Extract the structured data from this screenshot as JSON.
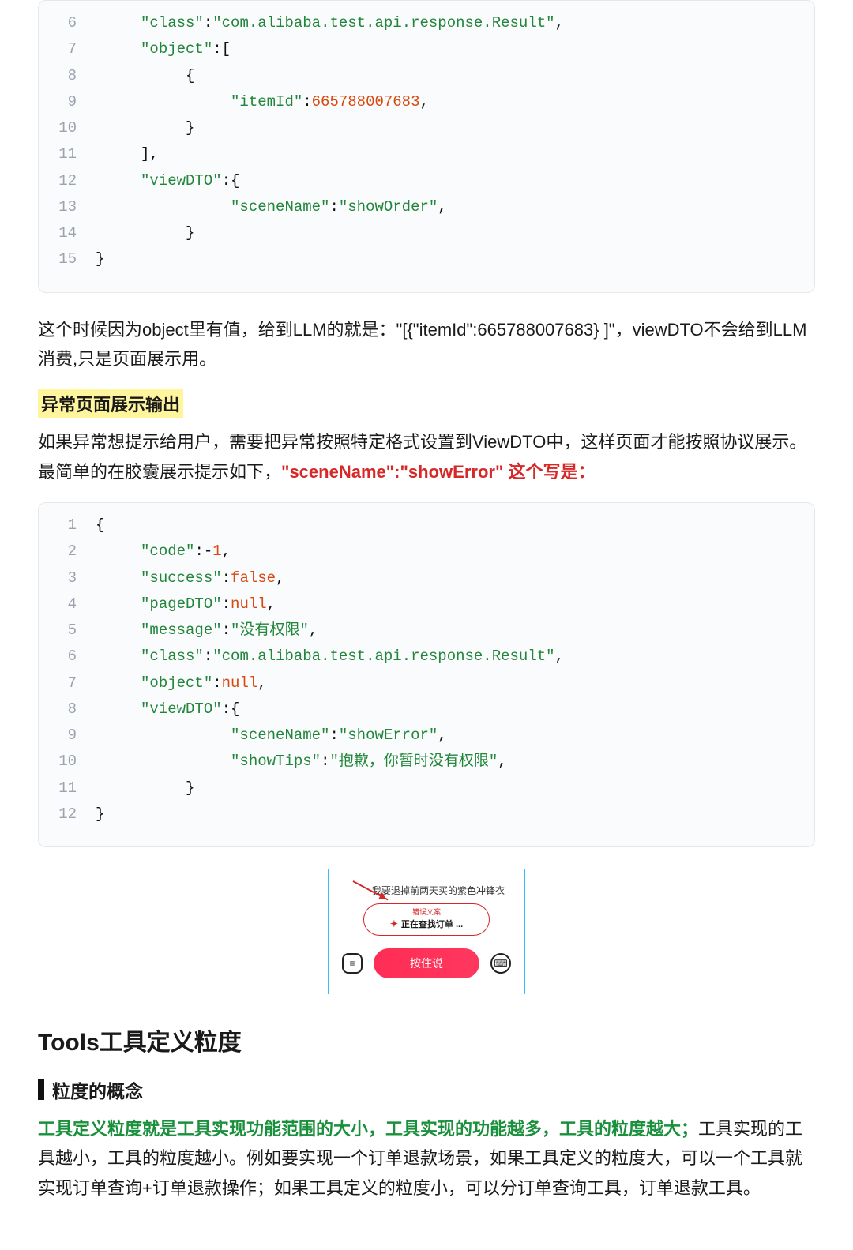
{
  "code1": {
    "lines": [
      {
        "n": "6",
        "t": [
          {
            "c": "p",
            "v": "     "
          },
          {
            "c": "k",
            "v": "\"class\""
          },
          {
            "c": "p",
            "v": ":"
          },
          {
            "c": "k",
            "v": "\"com.alibaba.test.api.response.Result\""
          },
          {
            "c": "p",
            "v": ","
          }
        ]
      },
      {
        "n": "7",
        "t": [
          {
            "c": "p",
            "v": "     "
          },
          {
            "c": "k",
            "v": "\"object\""
          },
          {
            "c": "p",
            "v": ":["
          }
        ]
      },
      {
        "n": "8",
        "t": [
          {
            "c": "p",
            "v": "          {"
          }
        ]
      },
      {
        "n": "9",
        "t": [
          {
            "c": "p",
            "v": "               "
          },
          {
            "c": "k",
            "v": "\"itemId\""
          },
          {
            "c": "p",
            "v": ":"
          },
          {
            "c": "n",
            "v": "665788007683"
          },
          {
            "c": "p",
            "v": ","
          }
        ]
      },
      {
        "n": "10",
        "t": [
          {
            "c": "p",
            "v": "          }"
          }
        ]
      },
      {
        "n": "11",
        "t": [
          {
            "c": "p",
            "v": "     ],"
          }
        ]
      },
      {
        "n": "12",
        "t": [
          {
            "c": "p",
            "v": "     "
          },
          {
            "c": "k",
            "v": "\"viewDTO\""
          },
          {
            "c": "p",
            "v": ":{"
          }
        ]
      },
      {
        "n": "13",
        "t": [
          {
            "c": "p",
            "v": "               "
          },
          {
            "c": "k",
            "v": "\"sceneName\""
          },
          {
            "c": "p",
            "v": ":"
          },
          {
            "c": "k",
            "v": "\"showOrder\""
          },
          {
            "c": "p",
            "v": ","
          }
        ]
      },
      {
        "n": "14",
        "t": [
          {
            "c": "p",
            "v": "          }"
          }
        ]
      },
      {
        "n": "15",
        "t": [
          {
            "c": "p",
            "v": "}"
          }
        ]
      }
    ]
  },
  "para1": "这个时候因为object里有值，给到LLM的就是：\"[{\"itemId\":665788007683} ]\"，viewDTO不会给到LLM消费,只是页面展示用。",
  "highlight": "异常页面展示输出",
  "para2a": "如果异常想提示给用户，需要把异常按照特定格式设置到ViewDTO中，这样页面才能按照协议展示。最简单的在胶囊展示提示如下，",
  "para2b": "\"sceneName\":\"showError\" 这个写是：",
  "code2": {
    "lines": [
      {
        "n": "1",
        "t": [
          {
            "c": "p",
            "v": "{"
          }
        ]
      },
      {
        "n": "2",
        "t": [
          {
            "c": "p",
            "v": "     "
          },
          {
            "c": "k",
            "v": "\"code\""
          },
          {
            "c": "p",
            "v": ":-"
          },
          {
            "c": "n",
            "v": "1"
          },
          {
            "c": "p",
            "v": ","
          }
        ]
      },
      {
        "n": "3",
        "t": [
          {
            "c": "p",
            "v": "     "
          },
          {
            "c": "k",
            "v": "\"success\""
          },
          {
            "c": "p",
            "v": ":"
          },
          {
            "c": "kw",
            "v": "false"
          },
          {
            "c": "p",
            "v": ","
          }
        ]
      },
      {
        "n": "4",
        "t": [
          {
            "c": "p",
            "v": "     "
          },
          {
            "c": "k",
            "v": "\"pageDTO\""
          },
          {
            "c": "p",
            "v": ":"
          },
          {
            "c": "kw",
            "v": "null"
          },
          {
            "c": "p",
            "v": ","
          }
        ]
      },
      {
        "n": "5",
        "t": [
          {
            "c": "p",
            "v": "     "
          },
          {
            "c": "k",
            "v": "\"message\""
          },
          {
            "c": "p",
            "v": ":"
          },
          {
            "c": "k",
            "v": "\"没有权限\""
          },
          {
            "c": "p",
            "v": ","
          }
        ]
      },
      {
        "n": "6",
        "t": [
          {
            "c": "p",
            "v": "     "
          },
          {
            "c": "k",
            "v": "\"class\""
          },
          {
            "c": "p",
            "v": ":"
          },
          {
            "c": "k",
            "v": "\"com.alibaba.test.api.response.Result\""
          },
          {
            "c": "p",
            "v": ","
          }
        ]
      },
      {
        "n": "7",
        "t": [
          {
            "c": "p",
            "v": "     "
          },
          {
            "c": "k",
            "v": "\"object\""
          },
          {
            "c": "p",
            "v": ":"
          },
          {
            "c": "kw",
            "v": "null"
          },
          {
            "c": "p",
            "v": ","
          }
        ]
      },
      {
        "n": "8",
        "t": [
          {
            "c": "p",
            "v": "     "
          },
          {
            "c": "k",
            "v": "\"viewDTO\""
          },
          {
            "c": "p",
            "v": ":{"
          }
        ]
      },
      {
        "n": "9",
        "t": [
          {
            "c": "p",
            "v": "               "
          },
          {
            "c": "k",
            "v": "\"sceneName\""
          },
          {
            "c": "p",
            "v": ":"
          },
          {
            "c": "k",
            "v": "\"showError\""
          },
          {
            "c": "p",
            "v": ","
          }
        ]
      },
      {
        "n": "10",
        "t": [
          {
            "c": "p",
            "v": "               "
          },
          {
            "c": "k",
            "v": "\"showTips\""
          },
          {
            "c": "p",
            "v": ":"
          },
          {
            "c": "k",
            "v": "\"抱歉，你暂时没有权限\""
          },
          {
            "c": "p",
            "v": ","
          }
        ]
      },
      {
        "n": "11",
        "t": [
          {
            "c": "p",
            "v": "          }"
          }
        ]
      },
      {
        "n": "12",
        "t": [
          {
            "c": "p",
            "v": "}"
          }
        ]
      }
    ]
  },
  "mock": {
    "userText": "我要退掉前两天买的紫色冲锋衣",
    "pillSmall": "错误文案",
    "pillText": "正在查找订单 ...",
    "holdText": "按住说",
    "listGlyph": "≡",
    "micGlyph": "⌨"
  },
  "h2": "Tools工具定义粒度",
  "sub": "粒度的概念",
  "para3a": "工具定义粒度就是工具实现功能范围的大小，工具实现的功能越多，工具的粒度越大；",
  "para3b": "工具实现的工具越小，工具的粒度越小。例如要实现一个订单退款场景，如果工具定义的粒度大，可以一个工具就实现订单查询+订单退款操作；如果工具定义的粒度小，可以分订单查询工具，订单退款工具。"
}
